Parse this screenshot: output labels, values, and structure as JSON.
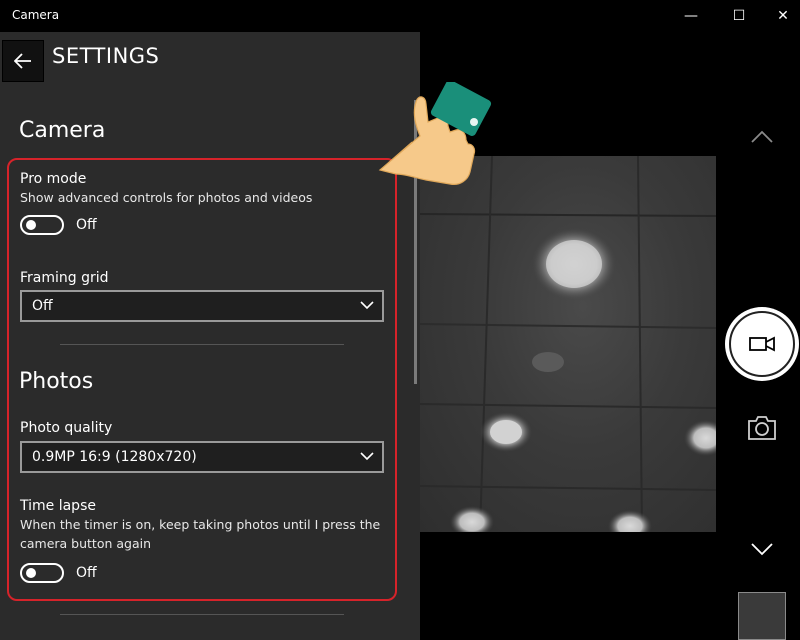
{
  "window": {
    "title": "Camera",
    "minimize_glyph": "—",
    "maximize_glyph": "☐",
    "close_glyph": "✕"
  },
  "settings": {
    "title": "SETTINGS",
    "back_icon": "arrow-left-icon",
    "camera_section": {
      "heading": "Camera",
      "pro_mode": {
        "label": "Pro mode",
        "description": "Show advanced controls for photos and videos",
        "state": "Off"
      },
      "framing_grid": {
        "label": "Framing grid",
        "value": "Off"
      }
    },
    "photos_section": {
      "heading": "Photos",
      "photo_quality": {
        "label": "Photo quality",
        "value": "0.9MP 16:9 (1280x720)"
      },
      "time_lapse": {
        "label": "Time lapse",
        "description_line1": "When the timer is on, keep taking photos until I press the",
        "description_line2": "camera button again",
        "state": "Off"
      }
    }
  },
  "controls": {
    "up_icon": "chevron-up-icon",
    "video_icon": "video-camera-icon",
    "photo_icon": "camera-icon",
    "down_icon": "chevron-down-icon"
  },
  "colors": {
    "highlight": "#d6232a",
    "panel": "#2b2b2b",
    "cuff": "#1a8f7a",
    "skin": "#f6c98a"
  }
}
